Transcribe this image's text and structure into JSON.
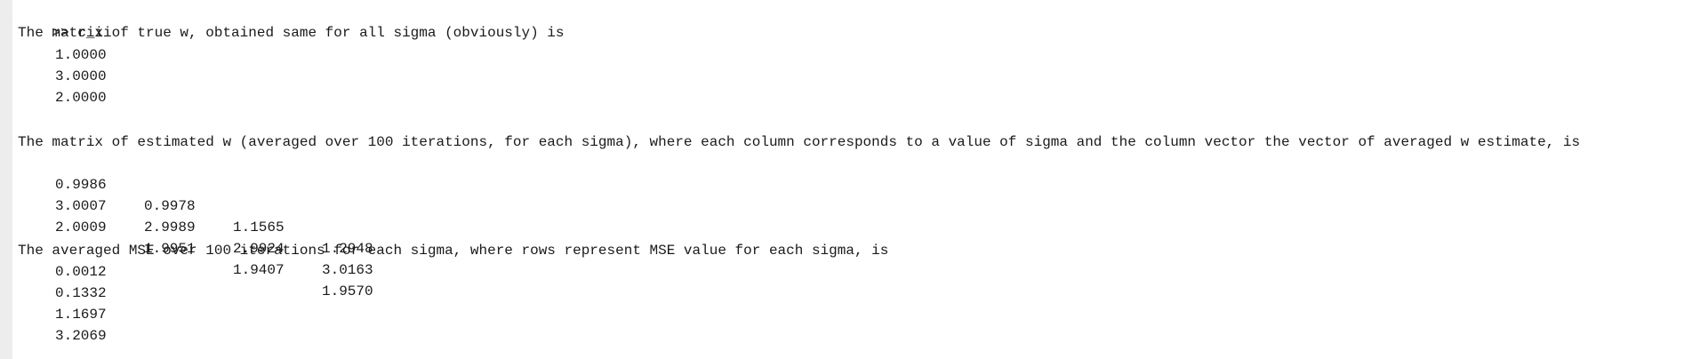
{
  "command": {
    "prompt": ">>",
    "text": "c_ii"
  },
  "true_w": {
    "caption": "The matrix of true w, obtained same for all sigma (obviously) is",
    "values": [
      "1.0000",
      "3.0000",
      "2.0000"
    ]
  },
  "estimated_w": {
    "caption": "The matrix of estimated w (averaged over 100 iterations, for each sigma), where each column corresponds to a value of sigma and the column vector the vector of averaged w estimate, is",
    "rows": [
      [
        "0.9986",
        "0.9978",
        "1.1565",
        "1.2948"
      ],
      [
        "3.0007",
        "2.9989",
        "2.9924",
        "3.0163"
      ],
      [
        "2.0009",
        "1.9951",
        "1.9407",
        "1.9570"
      ]
    ]
  },
  "mse": {
    "caption": "The averaged MSE over 100 iterations for each sigma, where rows represent MSE value for each sigma, is",
    "values": [
      "0.0012",
      "0.1332",
      "1.1697",
      "3.2069"
    ]
  }
}
